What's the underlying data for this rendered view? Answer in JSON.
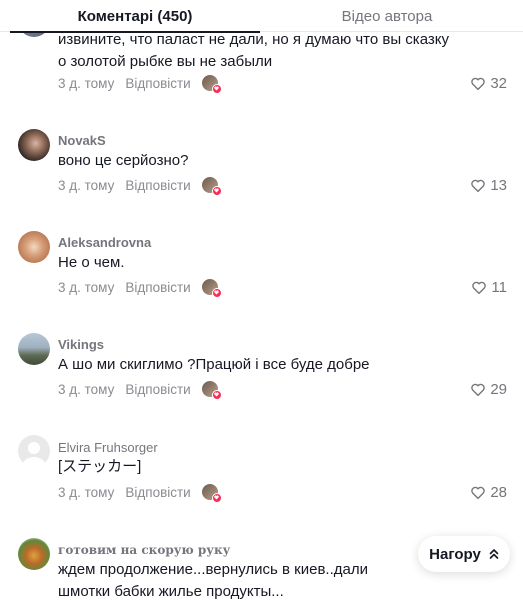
{
  "tabs": {
    "comments": "Коментарі (450)",
    "author_videos": "Відео автора"
  },
  "reply_label": "Відповісти",
  "comments": [
    {
      "username": "",
      "text": "извините, что паласт не дали, но я думаю что вы сказку о золотой рыбке вы не забыли",
      "time": "3 д. тому",
      "likes": "32"
    },
    {
      "username": "NovakS",
      "text": "воно це серйозно?",
      "time": "3 д. тому",
      "likes": "13"
    },
    {
      "username": "Aleksandrovna",
      "text": "Не о чем.",
      "time": "3 д. тому",
      "likes": "11"
    },
    {
      "username": "Vikings",
      "text": "А шо ми скиглимо ?Працюй і все буде добре",
      "time": "3 д. тому",
      "likes": "29"
    },
    {
      "username": "Elvira Fruhsorger",
      "text": "[ステッカー]",
      "time": "3 д. тому",
      "likes": "28"
    },
    {
      "username": "готовим на скорую руку",
      "text": "ждем продолжение...вернулись в киев..дали шмотки бабки жилье продукты...",
      "time": "",
      "likes": ""
    }
  ],
  "back_to_top": {
    "label": "Нагору"
  },
  "icons": {
    "like": "heart-outline-icon",
    "creator_liked": "creator-liked-icon",
    "up": "chevron-double-up-icon"
  },
  "colors": {
    "accent": "#fe2c55",
    "text": "#161823",
    "secondary": "#75767c"
  }
}
